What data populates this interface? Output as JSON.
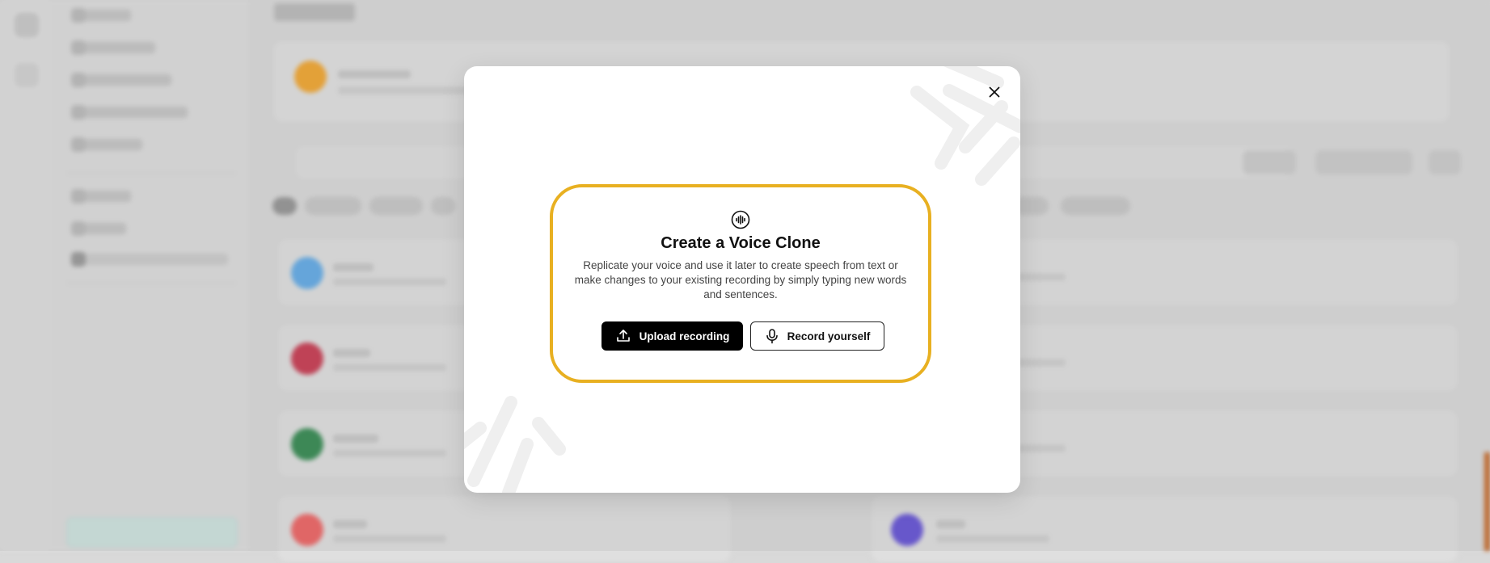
{
  "modal": {
    "title": "Create a Voice Clone",
    "description": "Replicate your voice and use it later to create speech from text or make changes to your existing recording by simply typing new words and sentences.",
    "upload_label": "Upload recording",
    "record_label": "Record yourself",
    "accent_color": "#e8b021",
    "icons": {
      "header": "waveform-icon",
      "close": "close-icon",
      "upload": "upload-icon",
      "record": "microphone-icon"
    }
  },
  "background": {
    "avatar_colors": [
      "#f0a93a",
      "#6aaee6",
      "#c9455a",
      "#3f8f5a",
      "#ec6b6b",
      "#6c5bd6"
    ]
  }
}
